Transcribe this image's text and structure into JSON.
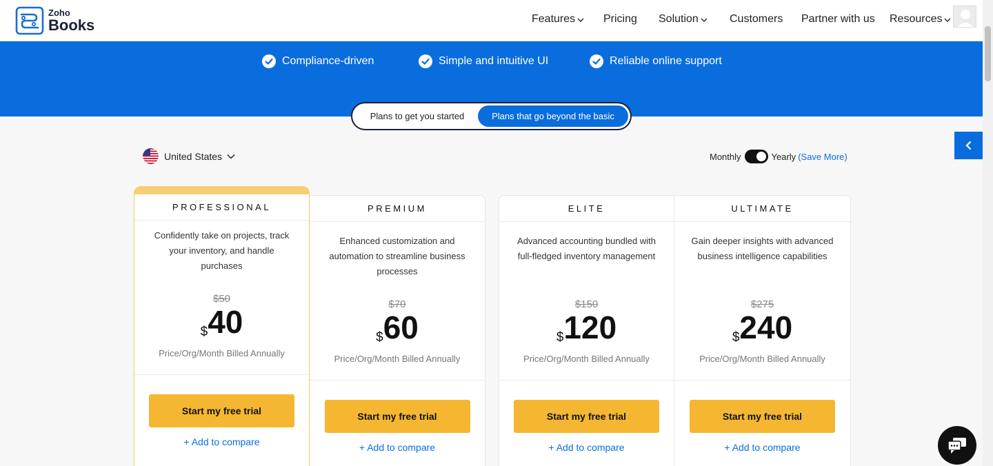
{
  "header": {
    "logo_small": "Zoho",
    "logo_big": "Books",
    "nav": [
      {
        "label": "Features",
        "dropdown": true
      },
      {
        "label": "Pricing",
        "dropdown": false
      },
      {
        "label": "Solution",
        "dropdown": true
      },
      {
        "label": "Customers",
        "dropdown": false
      },
      {
        "label": "Partner with us",
        "dropdown": false
      },
      {
        "label": "Resources",
        "dropdown": true
      }
    ]
  },
  "band": {
    "features": [
      "Compliance-driven",
      "Simple and intuitive UI",
      "Reliable online support"
    ]
  },
  "plan_toggle": {
    "options": [
      "Plans to get you started",
      "Plans that go beyond the basic"
    ],
    "selected": "Plans that go beyond the basic"
  },
  "country": {
    "name": "United States"
  },
  "billing": {
    "monthly": "Monthly",
    "yearly": "Yearly",
    "save_more": "(Save More)",
    "selected": "Yearly"
  },
  "plans": [
    {
      "name": "PROFESSIONAL",
      "description": "Confidently take on projects, track your inventory, and handle purchases",
      "old_price": "$50",
      "currency": "$",
      "price": "40",
      "billing_note": "Price/Org/Month Billed Annually",
      "cta": "Start my free trial",
      "compare": "+ Add to compare",
      "highlighted": true
    },
    {
      "name": "PREMIUM",
      "description": "Enhanced customization and automation to streamline business processes",
      "old_price": "$70",
      "currency": "$",
      "price": "60",
      "billing_note": "Price/Org/Month Billed Annually",
      "cta": "Start my free trial",
      "compare": "+ Add to compare",
      "highlighted": false
    },
    {
      "name": "ELITE",
      "description": "Advanced accounting bundled with full-fledged inventory management",
      "old_price": "$150",
      "currency": "$",
      "price": "120",
      "billing_note": "Price/Org/Month Billed Annually",
      "cta": "Start my free trial",
      "compare": "+ Add to compare",
      "highlighted": false
    },
    {
      "name": "ULTIMATE",
      "description": "Gain deeper insights with advanced business intelligence capabilities",
      "old_price": "$275",
      "currency": "$",
      "price": "240",
      "billing_note": "Price/Org/Month Billed Annually",
      "cta": "Start my free trial",
      "compare": "+ Add to compare",
      "highlighted": false
    }
  ],
  "colors": {
    "brand_blue": "#0a6ddd",
    "cta_yellow": "#f5b731",
    "highlight_gold": "#f7cf72",
    "dark": "#1b2134"
  },
  "icons": {
    "check": "check-circle-icon",
    "chevron": "chevron-down-icon",
    "side_tab": "chevron-left-icon",
    "chat": "chat-bubble-icon"
  }
}
